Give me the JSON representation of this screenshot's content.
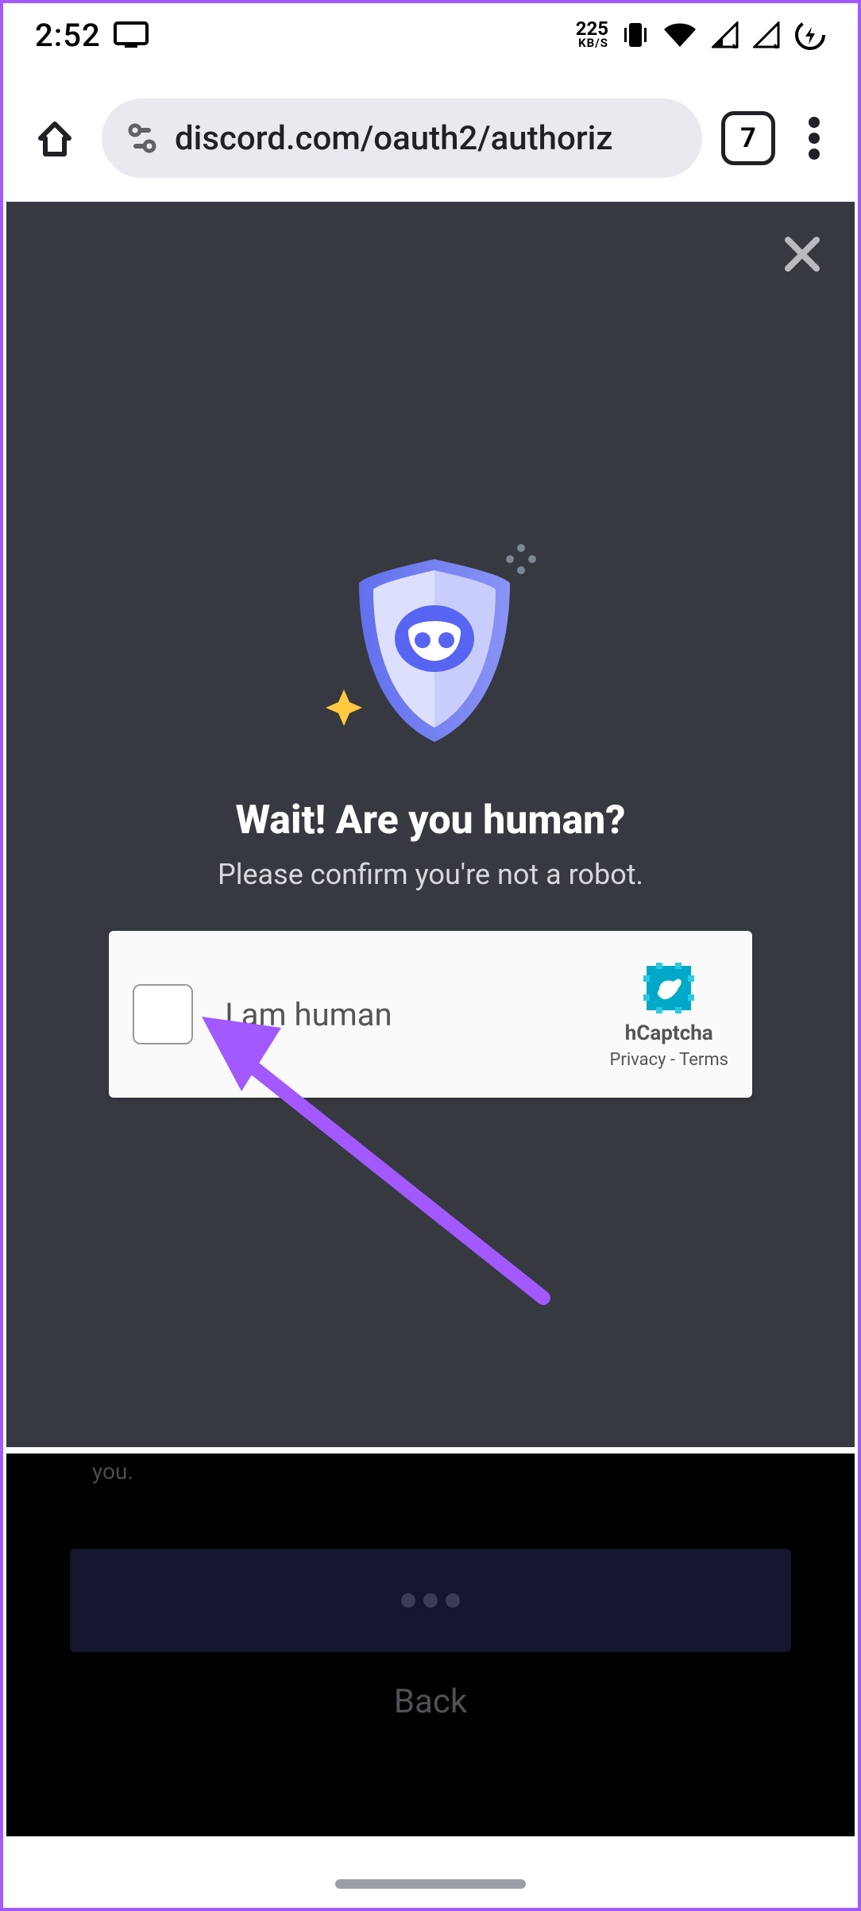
{
  "statusbar": {
    "time": "2:52",
    "net_speed_value": "225",
    "net_speed_unit": "KB/S"
  },
  "browser": {
    "url": "discord.com/oauth2/authoriz",
    "tab_count": "7"
  },
  "modal": {
    "title": "Wait! Are you human?",
    "subtitle": "Please confirm you're not a robot."
  },
  "captcha": {
    "checkbox_label": "I am human",
    "brand": "hCaptcha",
    "privacy": "Privacy",
    "terms": "Terms",
    "links_separator": " - "
  },
  "bottom": {
    "fragment": "you.",
    "back_label": "Back"
  },
  "colors": {
    "border": "#a259ff",
    "discord_dark": "#36393f",
    "shield_primary": "#6270ed",
    "shield_light": "#c8cdfb",
    "hcaptcha_blue": "#00b8d4"
  }
}
